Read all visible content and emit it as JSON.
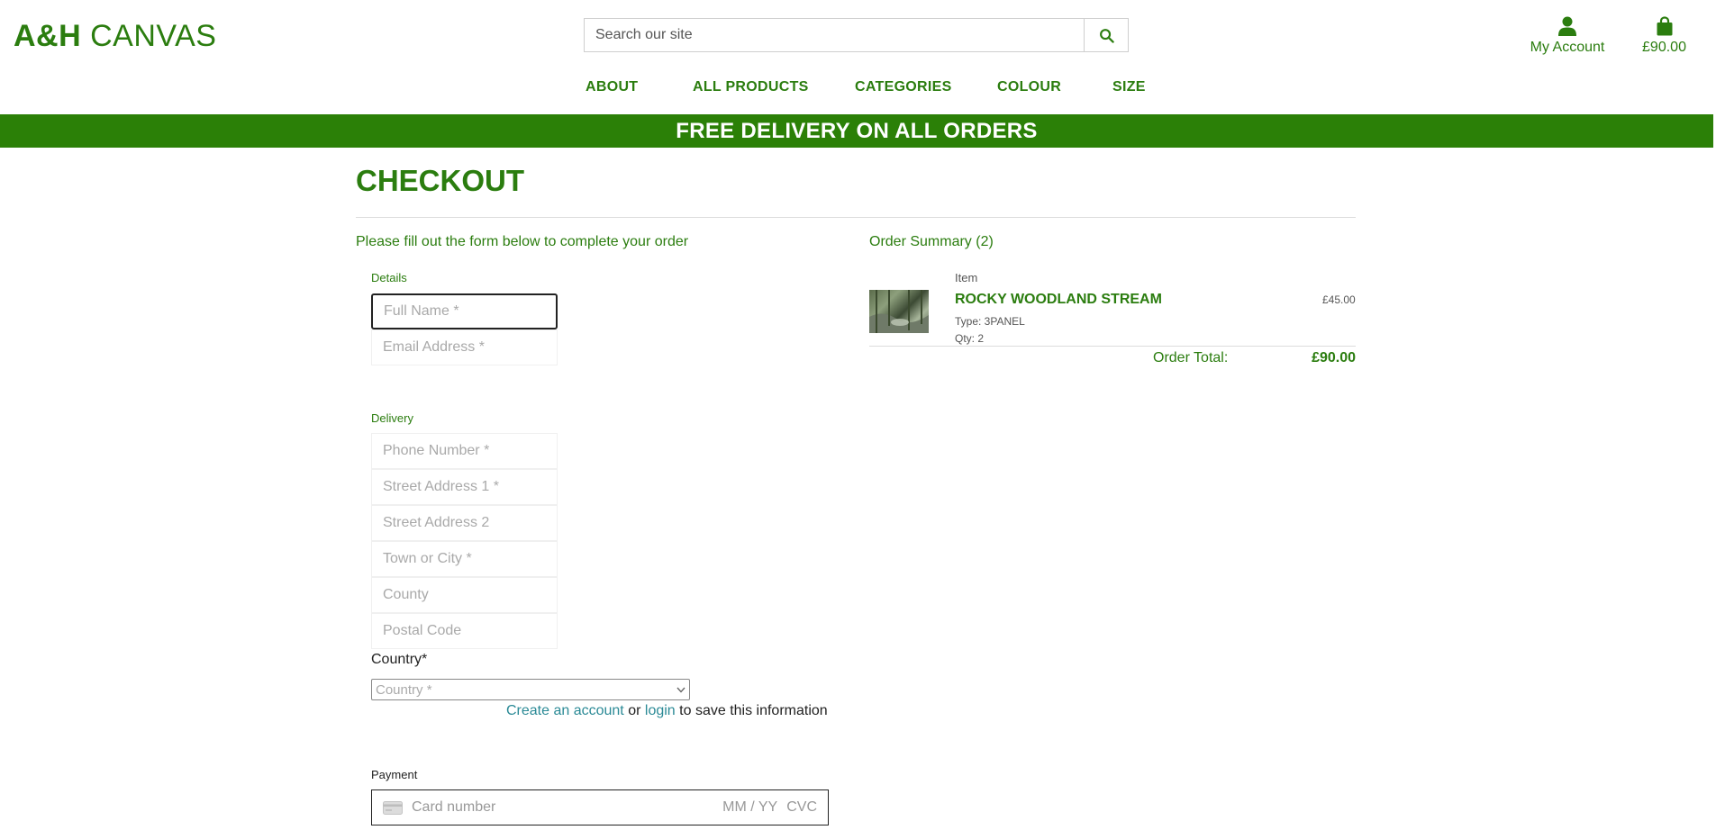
{
  "header": {
    "logo_bold": "A&H",
    "logo_light": "CANVAS",
    "search_placeholder": "Search our site",
    "account_label": "My Account",
    "bag_total": "£90.00"
  },
  "nav": {
    "items": [
      "ABOUT",
      "ALL PRODUCTS",
      "CATEGORIES",
      "COLOUR",
      "SIZE"
    ]
  },
  "banner": "FREE DELIVERY ON ALL ORDERS",
  "checkout": {
    "title": "CHECKOUT",
    "intro": "Please fill out the form below to complete your order",
    "details_label": "Details",
    "full_name_placeholder": "Full Name *",
    "email_placeholder": "Email Address *",
    "delivery_label": "Delivery",
    "phone_placeholder": "Phone Number *",
    "street1_placeholder": "Street Address 1 *",
    "street2_placeholder": "Street Address 2",
    "town_placeholder": "Town or City *",
    "county_placeholder": "County",
    "postcode_placeholder": "Postal Code",
    "country_label": "Country*",
    "country_value": "Country *",
    "create_account_link": "Create an account",
    "or_text": "or",
    "login_link": "login",
    "save_info_text": "to save this information",
    "payment_label": "Payment",
    "card_number_placeholder": "Card number",
    "card_expiry_placeholder": "MM / YY",
    "card_cvc_placeholder": "CVC"
  },
  "summary": {
    "title": "Order Summary (2)",
    "item_header": "Item",
    "item": {
      "name": "ROCKY WOODLAND STREAM",
      "type": "Type: 3PANEL",
      "qty": "Qty: 2",
      "price": "£45.00"
    },
    "total_label": "Order Total:",
    "total_value": "£90.00"
  },
  "colors": {
    "brand_green": "#2b7d0f",
    "banner_green": "#2b8007",
    "link_teal": "#2b8a96"
  },
  "icons": [
    "search-icon",
    "user-icon",
    "shopping-bag-icon",
    "chevron-down-icon",
    "credit-card-icon"
  ]
}
